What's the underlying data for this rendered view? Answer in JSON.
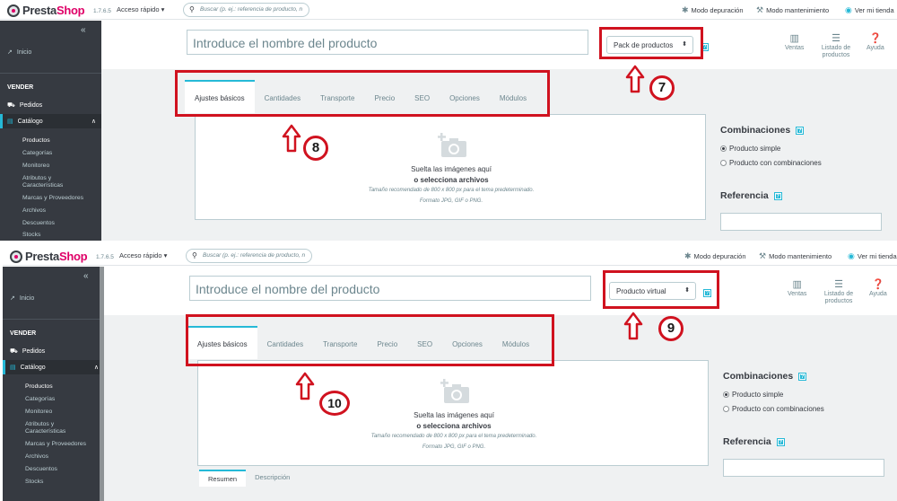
{
  "colors": {
    "accent": "#25b9d7",
    "brand": "#df0067",
    "sidebar": "#363a41",
    "annotation": "#d0121f"
  },
  "topbar": {
    "logo_pre": "Presta",
    "logo_post": "Shop",
    "version": "1.7.6.5",
    "quick_access": "Acceso rápido",
    "search_placeholder": "Buscar (p. ej.: referencia de producto, n",
    "debug": "Modo depuración",
    "maintenance": "Modo mantenimiento",
    "view_store": "Ver mi tienda"
  },
  "sidebar": {
    "home": "Inicio",
    "section": "VENDER",
    "orders": "Pedidos",
    "catalog": "Catálogo",
    "submenu": [
      "Productos",
      "Categorías",
      "Monitoreo",
      "Atributos y",
      "Características",
      "Marcas y Proveedores",
      "Archivos",
      "Descuentos",
      "Stocks"
    ]
  },
  "header": {
    "name_placeholder": "Introduce el nombre del producto",
    "help": "?",
    "tools": {
      "sales": "Ventas",
      "list_1": "Listado de",
      "list_2": "productos",
      "help": "Ayuda"
    }
  },
  "tabs": [
    "Ajustes básicos",
    "Cantidades",
    "Transporte",
    "Precio",
    "SEO",
    "Opciones",
    "Módulos"
  ],
  "dropzone": {
    "line1": "Suelta las imágenes aquí",
    "line2": "o selecciona archivos",
    "line3": "Tamaño recomendado de 800 x 800 px para el tema predeterminado.",
    "line4": "Formato JPG, GIF o PNG."
  },
  "combinations": {
    "title": "Combinaciones",
    "option_simple": "Producto simple",
    "option_combo": "Producto con combinaciones"
  },
  "reference": {
    "title": "Referencia"
  },
  "panels": [
    {
      "type_value": "Pack de productos",
      "marker_tabs": "8",
      "marker_type": "7"
    },
    {
      "type_value": "Producto virtual",
      "marker_tabs": "10",
      "marker_type": "9",
      "bottom_tabs": [
        "Resumen",
        "Descripción"
      ]
    }
  ]
}
